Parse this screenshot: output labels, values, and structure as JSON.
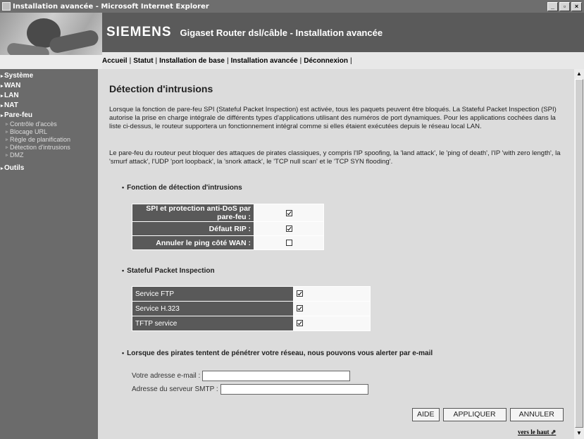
{
  "window": {
    "title": "Installation avancée - Microsoft Internet Explorer",
    "min": "_",
    "max": "▫",
    "close": "×"
  },
  "header": {
    "brand": "SIEMENS",
    "subtitle": "Gigaset Router dsl/câble  -  Installation avancée"
  },
  "nav": [
    "Accueil",
    "Statut",
    "Installation de base",
    "Installation avancée",
    "Déconnexion"
  ],
  "sidebar": {
    "items": [
      {
        "label": "Système"
      },
      {
        "label": "WAN"
      },
      {
        "label": "LAN"
      },
      {
        "label": "NAT"
      },
      {
        "label": "Pare-feu"
      }
    ],
    "subitems": [
      "Contrôle d'accès",
      "Blocage URL",
      "Règle de planification",
      "Détection d'intrusions",
      "DMZ"
    ],
    "outils": "Outils"
  },
  "page": {
    "title": "Détection d'intrusions",
    "para1": "Lorsque la fonction de pare-feu SPI (Stateful Packet Inspection) est activée, tous les paquets peuvent être bloqués.   La Stateful Packet Inspection (SPI) autorise la prise en charge intégrale de différents types d'applications utilisant des numéros de port dynamiques.   Pour les applications cochées dans la liste ci-dessus, le routeur supportera un fonctionnement intégral comme si elles étaient exécutées depuis le réseau local LAN.",
    "para2": "Le pare-feu du routeur peut bloquer des attaques de pirates classiques, y compris l'IP spoofing, la 'land attack', le 'ping of death', l'IP 'with zero length', la 'smurf attack', l'UDP 'port loopback', la 'snork attack', le 'TCP null scan' et le 'TCP SYN flooding'.",
    "section1": "Fonction de détection d'intrusions",
    "intrusion_rows": [
      {
        "label": "SPI et protection anti-DoS par pare-feu :",
        "checked": true
      },
      {
        "label": "Défaut RIP :",
        "checked": true
      },
      {
        "label": "Annuler le ping côté WAN :",
        "checked": false
      }
    ],
    "section2": "Stateful Packet Inspection",
    "spi_rows": [
      {
        "label": "Service FTP",
        "checked": true
      },
      {
        "label": "Service H.323",
        "checked": true
      },
      {
        "label": "TFTP  service",
        "checked": true
      }
    ],
    "section3": "Lorsque des pirates tentent de pénétrer votre réseau, nous pouvons vous alerter par e-mail",
    "email_label": "Votre adresse e-mail :",
    "email_value": "",
    "smtp_label": "Adresse du serveur SMTP :",
    "smtp_value": "",
    "buttons": {
      "aide": "AIDE",
      "appliquer": "APPLIQUER",
      "annuler": "ANNULER"
    },
    "top_link": "vers le haut"
  }
}
